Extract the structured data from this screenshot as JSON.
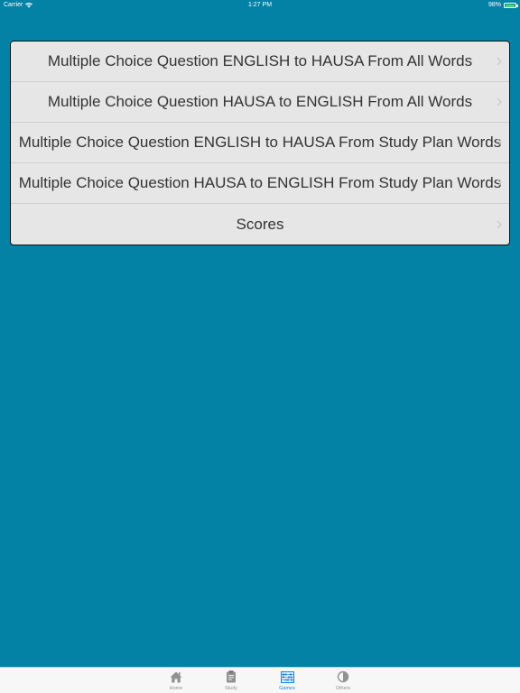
{
  "status_bar": {
    "carrier": "Carrier",
    "time": "1:27 PM",
    "battery_percent": "98%",
    "battery_level": 0.98
  },
  "menu": {
    "items": [
      {
        "label": "Multiple Choice Question ENGLISH to HAUSA From All Words"
      },
      {
        "label": "Multiple Choice Question HAUSA to ENGLISH From All Words"
      },
      {
        "label": "Multiple Choice Question ENGLISH to HAUSA From Study Plan Words"
      },
      {
        "label": "Multiple Choice Question HAUSA to ENGLISH From Study Plan Words"
      },
      {
        "label": "Scores"
      }
    ]
  },
  "tab_bar": {
    "items": [
      {
        "label": "Home",
        "icon": "home-icon"
      },
      {
        "label": "Study",
        "icon": "clipboard-icon"
      },
      {
        "label": "Games",
        "icon": "abacus-icon",
        "active": true
      },
      {
        "label": "Others",
        "icon": "contrast-icon"
      }
    ]
  },
  "colors": {
    "background": "#0382a6",
    "list_background": "#e6e6e6",
    "tab_active": "#1a86e8",
    "tab_inactive": "#929292",
    "battery": "#4cd964"
  }
}
